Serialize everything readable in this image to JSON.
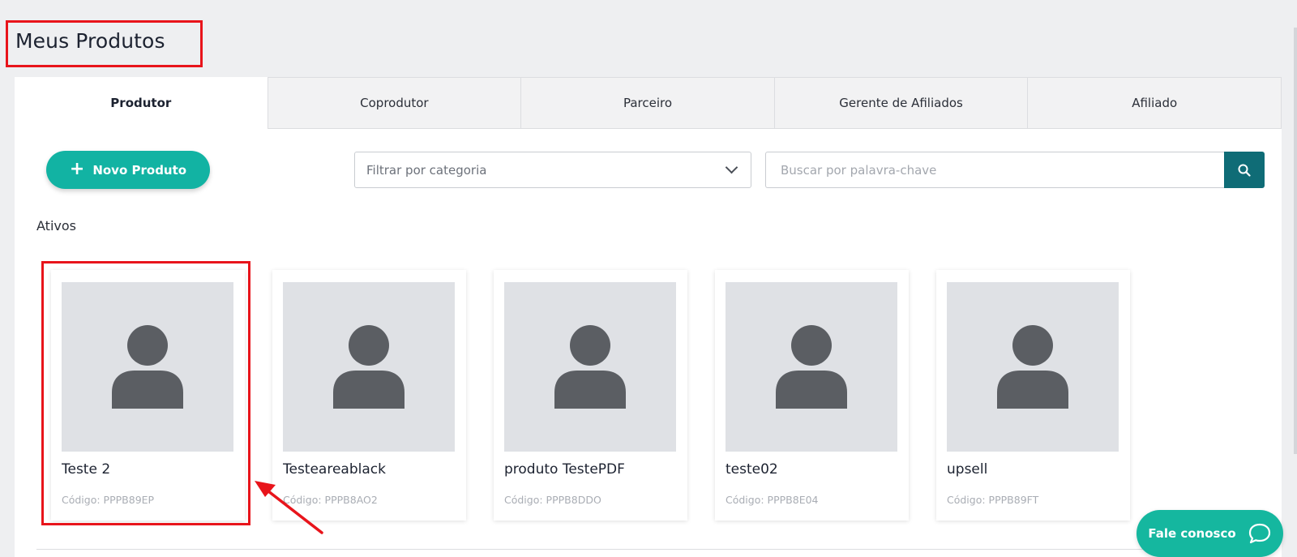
{
  "page": {
    "title": "Meus Produtos"
  },
  "tabs": [
    {
      "label": "Produtor",
      "active": true
    },
    {
      "label": "Coprodutor",
      "active": false
    },
    {
      "label": "Parceiro",
      "active": false
    },
    {
      "label": "Gerente de Afiliados",
      "active": false
    },
    {
      "label": "Afiliado",
      "active": false
    }
  ],
  "toolbar": {
    "new_product_label": "Novo Produto",
    "category_select_value": "Filtrar por categoria",
    "search_placeholder": "Buscar por palavra-chave"
  },
  "section": {
    "label": "Ativos"
  },
  "products": [
    {
      "name": "Teste 2",
      "code": "Código: PPPB89EP",
      "icon": "user-placeholder-icon"
    },
    {
      "name": "Testeareablack",
      "code": "Código: PPPB8AO2",
      "icon": "user-placeholder-icon"
    },
    {
      "name": "produto TestePDF",
      "code": "Código: PPPB8DDO",
      "icon": "user-placeholder-icon"
    },
    {
      "name": "teste02",
      "code": "Código: PPPB8E04",
      "icon": "user-placeholder-icon"
    },
    {
      "name": "upsell",
      "code": "Código: PPPB89FT",
      "icon": "user-placeholder-icon"
    }
  ],
  "chat": {
    "label": "Fale conosco"
  },
  "colors": {
    "accent": "#12b3a3",
    "search_button": "#0f6c76",
    "annotation": "#e8141b",
    "placeholder_bg": "#dfe1e5",
    "placeholder_icon": "#5b5e63"
  }
}
